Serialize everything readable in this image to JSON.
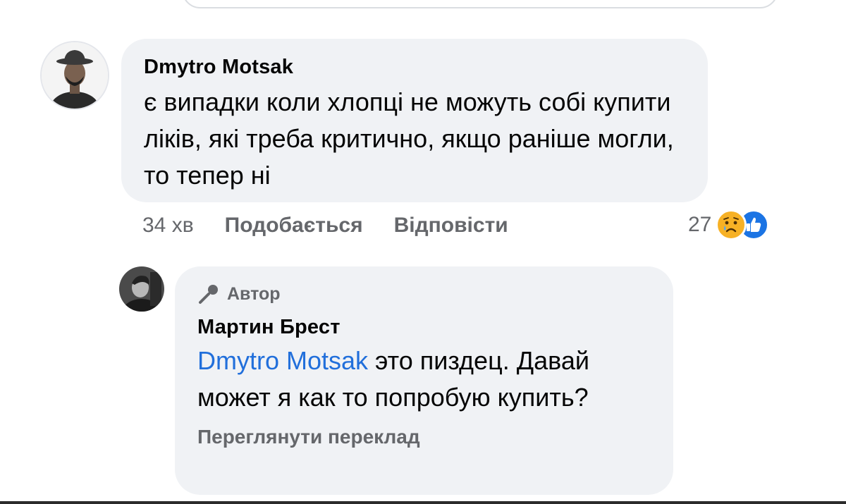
{
  "comment": {
    "author": "Dmytro Motsak",
    "text": "є випадки коли хлопці не можуть собі купити ліків, які треба критично, якщо раніше могли, то тепер ні",
    "time": "34 хв",
    "like_label": "Подобається",
    "reply_label": "Відповісти",
    "reaction_count": "27",
    "reactions": [
      "sad-icon",
      "like-icon"
    ]
  },
  "reply": {
    "badge": "Автор",
    "author": "Мартин Брест",
    "mention": "Dmytro Motsak",
    "text": " это пиздец. Давай может я как то попробую купить?",
    "translate_label": "Переглянути переклад"
  },
  "colors": {
    "bubble": "#f0f2f5",
    "secondary_text": "#65676b",
    "mention": "#216fdb",
    "like_blue": "#1b74e4",
    "sad_yellow": "#f7b125"
  }
}
